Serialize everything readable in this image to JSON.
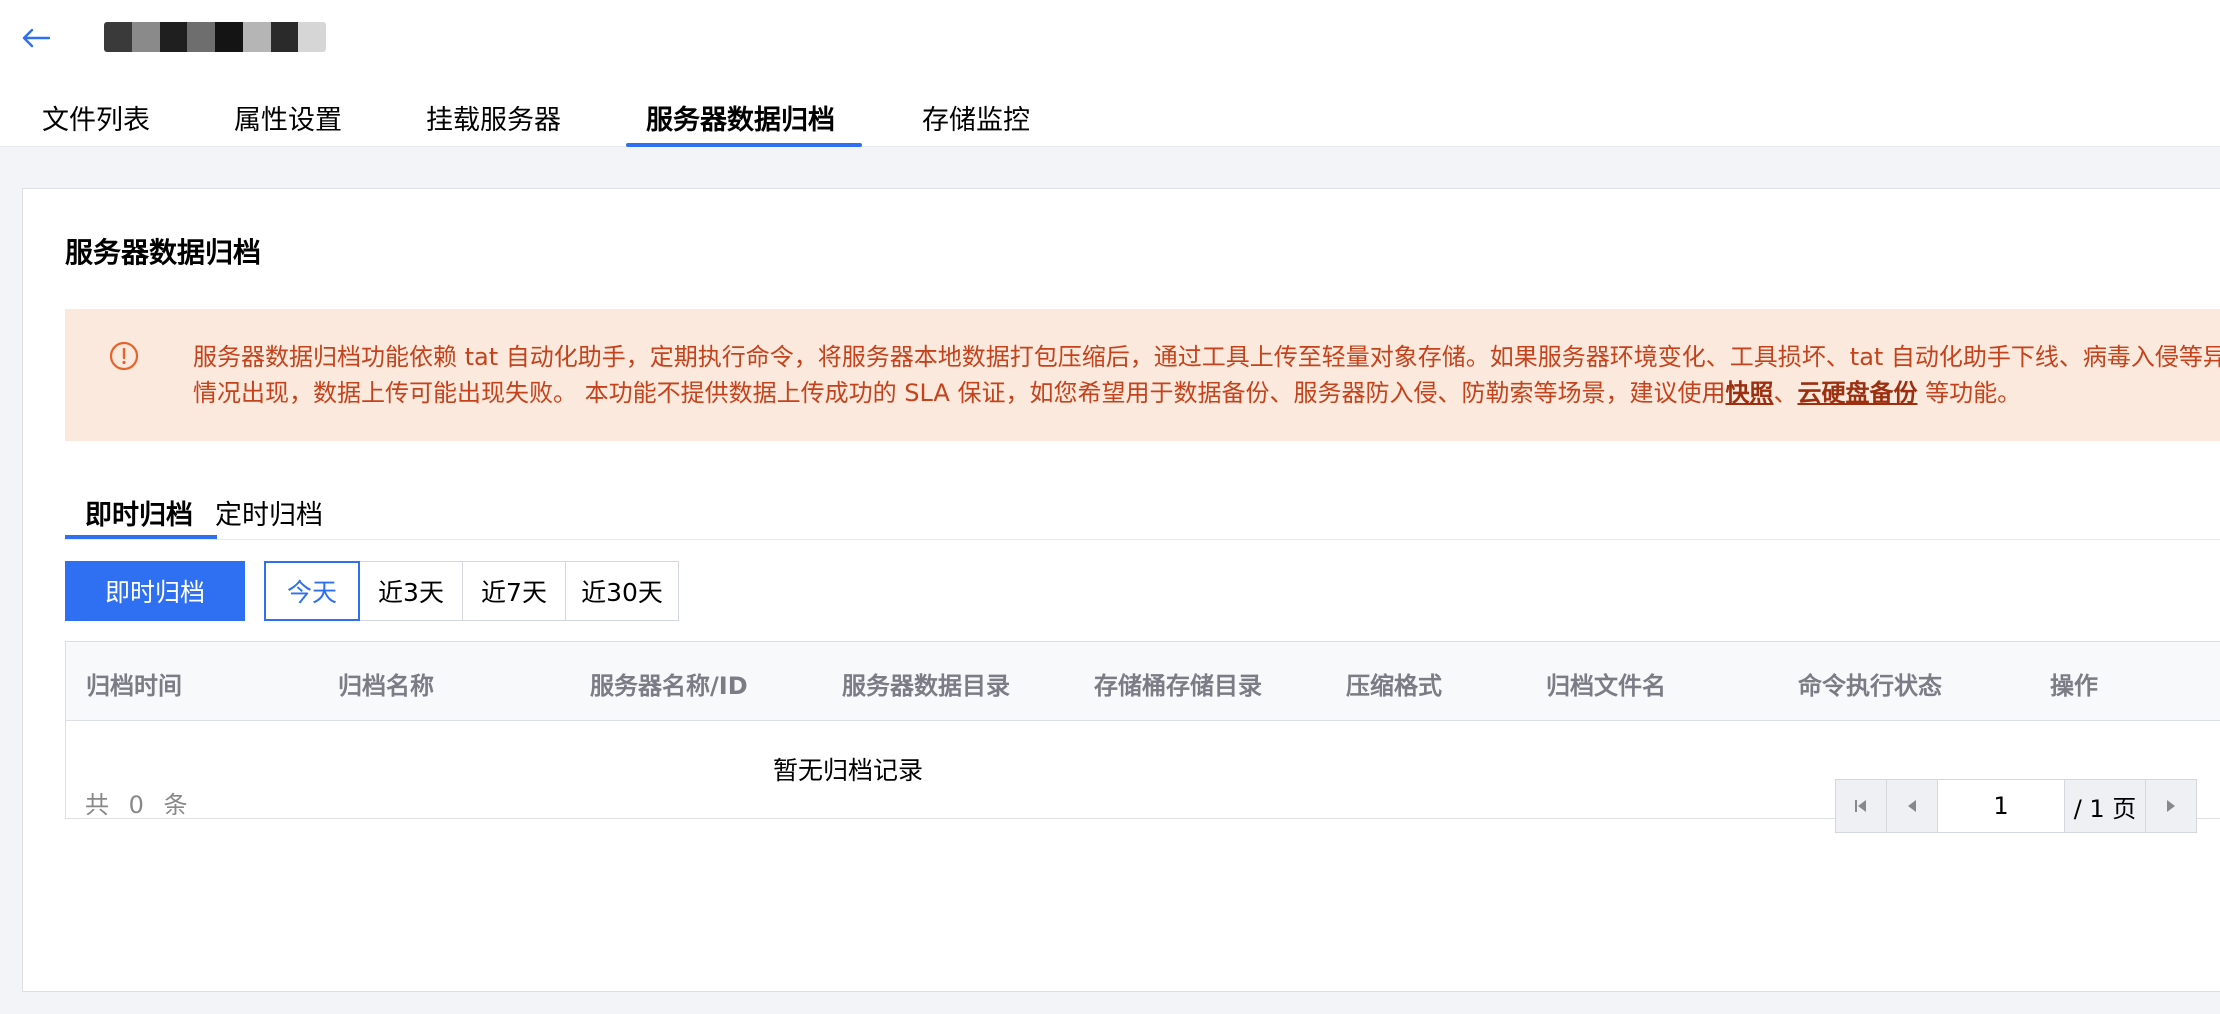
{
  "header": {
    "back_icon": "arrow-left-icon",
    "resource_name_blocks": [
      "#3a3a3a",
      "#8a8a8a",
      "#1f1f1f",
      "#6e6e6e",
      "#141414",
      "#b5b5b5",
      "#2a2a2a",
      "#d6d6d6"
    ]
  },
  "tabs": [
    {
      "label": "文件列表"
    },
    {
      "label": "属性设置"
    },
    {
      "label": "挂载服务器"
    },
    {
      "label": "服务器数据归档",
      "active": true
    },
    {
      "label": "存储监控"
    }
  ],
  "card": {
    "title": "服务器数据归档"
  },
  "alert": {
    "icon": "exclamation-circle-icon",
    "text_1": "服务器数据归档功能依赖 tat 自动化助手，定期执行命令，将服务器本地数据打包压缩后，通过工具上传至轻量对象存储。如果服务器环境变化、工具损坏、tat 自动化助手下线、病毒入侵等异常情况出现，数据上传可能出现失败。 本功能不提供数据上传成功的 SLA 保证，如您希望用于数据备份、服务器防入侵、防勒索等场景，建议使用",
    "link_1": "快照",
    "sep": "、",
    "link_2": "云硬盘备份",
    "text_2": " 等功能。"
  },
  "subtabs": [
    {
      "label": "即时归档",
      "active": true
    },
    {
      "label": "定时归档"
    }
  ],
  "actions": {
    "primary_label": "即时归档",
    "ranges": [
      {
        "label": "今天",
        "selected": true
      },
      {
        "label": "近3天"
      },
      {
        "label": "近7天"
      },
      {
        "label": "近30天"
      }
    ]
  },
  "table": {
    "columns": [
      "归档时间",
      "归档名称",
      "服务器名称/ID",
      "服务器数据目录",
      "存储桶存储目录",
      "压缩格式",
      "归档文件名",
      "命令执行状态",
      "操作"
    ],
    "empty_text": "暂无归档记录"
  },
  "footer": {
    "total_text": "共 0 条",
    "page_value": "1",
    "page_total": "/ 1 页"
  },
  "colors": {
    "accent": "#2f6ff2",
    "alert_bg": "#fce9dd",
    "alert_text": "#c4431c"
  }
}
